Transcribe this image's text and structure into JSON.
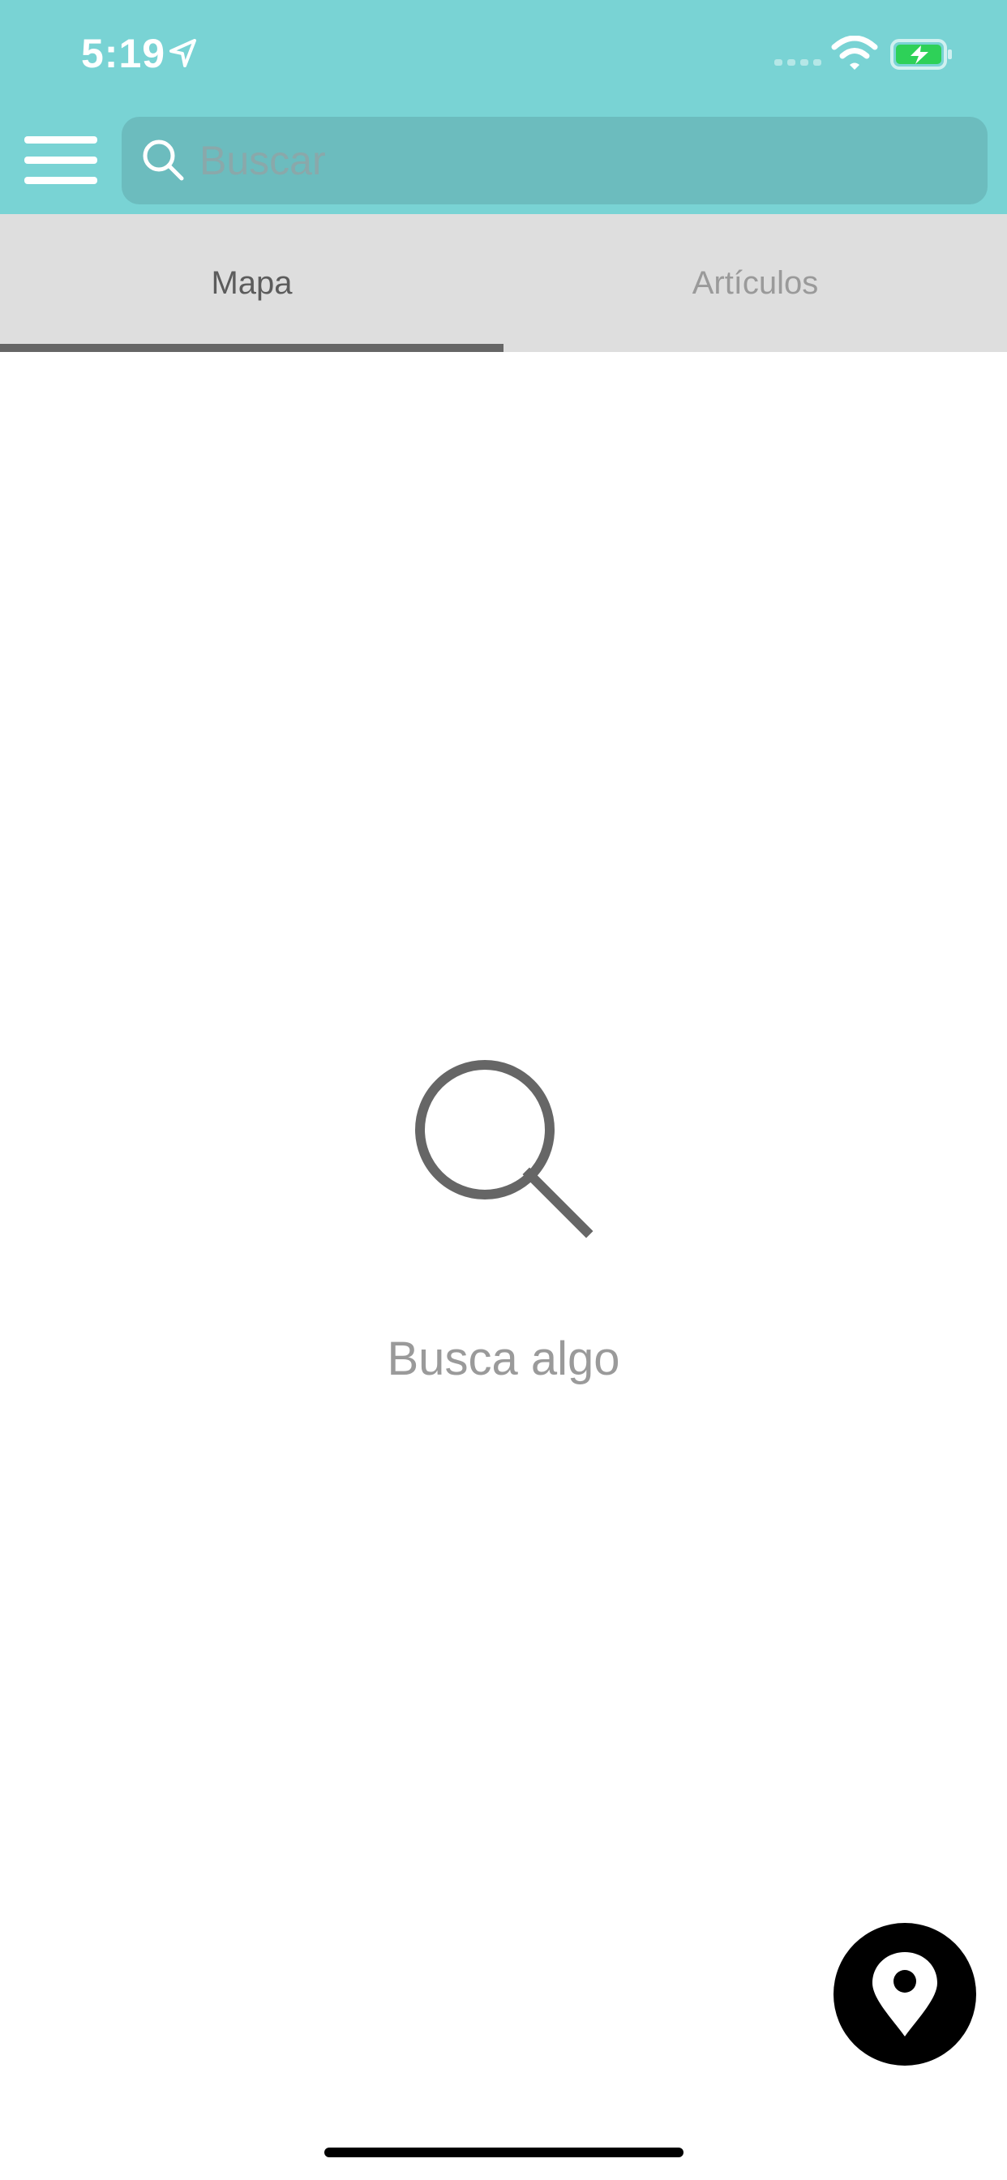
{
  "status_bar": {
    "time": "5:19",
    "icons": [
      "location-arrow-icon",
      "signal-icon",
      "wifi-icon",
      "battery-charging-icon"
    ]
  },
  "header": {
    "menu_icon": "hamburger-menu-icon",
    "search": {
      "placeholder": "Buscar",
      "value": ""
    }
  },
  "tabs": [
    {
      "label": "Mapa",
      "active": true
    },
    {
      "label": "Artículos",
      "active": false
    }
  ],
  "empty_state": {
    "icon": "search-icon",
    "message": "Busca algo"
  },
  "fab": {
    "icon": "location-pin-icon"
  },
  "colors": {
    "header": "#79d3d4",
    "search_box": "#6cbcbe",
    "tab_bar": "#dedede",
    "tab_indicator": "#666666",
    "empty_text": "#9a9a9a",
    "fab": "#000000",
    "battery": "#2ed158"
  }
}
